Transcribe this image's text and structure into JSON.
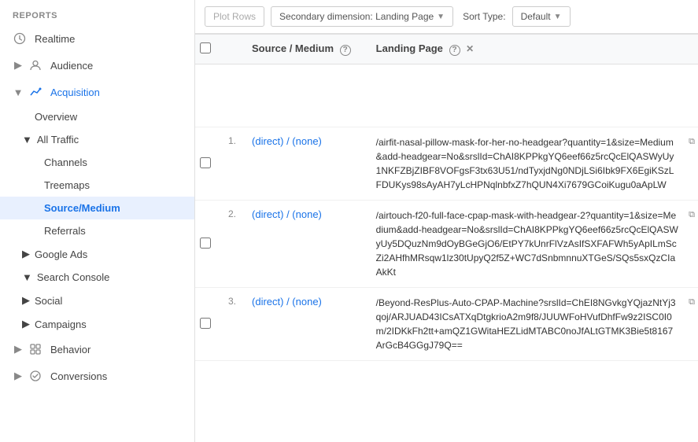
{
  "sidebar": {
    "reports_label": "REPORTS",
    "items": [
      {
        "id": "realtime",
        "label": "Realtime",
        "icon": "clock",
        "level": 0
      },
      {
        "id": "audience",
        "label": "Audience",
        "icon": "person",
        "level": 0,
        "expandable": true
      },
      {
        "id": "acquisition",
        "label": "Acquisition",
        "icon": "acquisition",
        "level": 0,
        "expandable": true,
        "expanded": true
      },
      {
        "id": "overview",
        "label": "Overview",
        "level": 1
      },
      {
        "id": "all-traffic",
        "label": "All Traffic",
        "level": 1,
        "expandable": true,
        "expanded": true
      },
      {
        "id": "channels",
        "label": "Channels",
        "level": 2
      },
      {
        "id": "treemaps",
        "label": "Treemaps",
        "level": 2
      },
      {
        "id": "source-medium",
        "label": "Source/Medium",
        "level": 2,
        "active": true
      },
      {
        "id": "referrals",
        "label": "Referrals",
        "level": 2
      },
      {
        "id": "google-ads",
        "label": "Google Ads",
        "level": 1,
        "expandable": true
      },
      {
        "id": "search-console",
        "label": "Search Console",
        "level": 1,
        "expandable": true,
        "expanded": true
      },
      {
        "id": "social",
        "label": "Social",
        "level": 1,
        "expandable": true
      },
      {
        "id": "campaigns",
        "label": "Campaigns",
        "level": 1,
        "expandable": true
      },
      {
        "id": "behavior",
        "label": "Behavior",
        "level": 0,
        "expandable": true,
        "icon": "behavior"
      },
      {
        "id": "conversions",
        "label": "Conversions",
        "level": 0,
        "expandable": true,
        "icon": "conversions"
      }
    ]
  },
  "toolbar": {
    "plot_rows_label": "Plot Rows",
    "secondary_dimension_label": "Secondary dimension: Landing Page",
    "sort_type_label": "Sort Type:",
    "default_label": "Default"
  },
  "table": {
    "col_checkbox": "",
    "col_source_medium": "Source / Medium",
    "col_source_medium_help": "?",
    "col_landing_page": "Landing Page",
    "col_landing_page_help": "?",
    "rows": [
      {
        "num": "1.",
        "source_medium": "(direct) / (none)",
        "landing_page": "/airfit-nasal-pillow-mask-for-her-no-headgear?quantity=1&size=Medium&add-headgear=No&srslId=ChAI8KPPkgYQ6eef66z5rcQcElQASWyUy1NKFZBjZIBF8VOFgsF3tx63U51/ndTyxjdNg0NDjLSi6Ibk9FX6EgiKSzLFDUKys98sAyAH7yLcHPNqlnbfxZ7hQUN4Xi7679GCoiKugu0aApLW"
      },
      {
        "num": "2.",
        "source_medium": "(direct) / (none)",
        "landing_page": "/airtouch-f20-full-face-cpap-mask-with-headgear-2?quantity=1&size=Medium&add-headgear=No&srslId=ChAI8KPPkgYQ6eef66z5rcQcElQASWyUy5DQuzNm9dOyBGeGjO6/EtPY7kUnrFlVzAsIfSXFAFWh5yApILmScZi2AHfhMRsqw1lz30tUpyQ2f5Z+WC7dSnbmnnuXTGeS/SQs5sxQzCIaAkKt"
      },
      {
        "num": "3.",
        "source_medium": "(direct) / (none)",
        "landing_page": "/Beyond-ResPlus-Auto-CPAP-Machine?srslId=ChEI8NGvkgYQjazNtYj3qoj/ARJUAD43ICsATXqDtgkrioA2m9f8/JUUWFoHVufDhfFw9z2ISC0I0m/2IDKkFh2tt+amQZ1GWitaHEZLidMTABC0noJfALtGTMK3Bie5t8167ArGcB4GGgJ79Q=="
      }
    ]
  }
}
